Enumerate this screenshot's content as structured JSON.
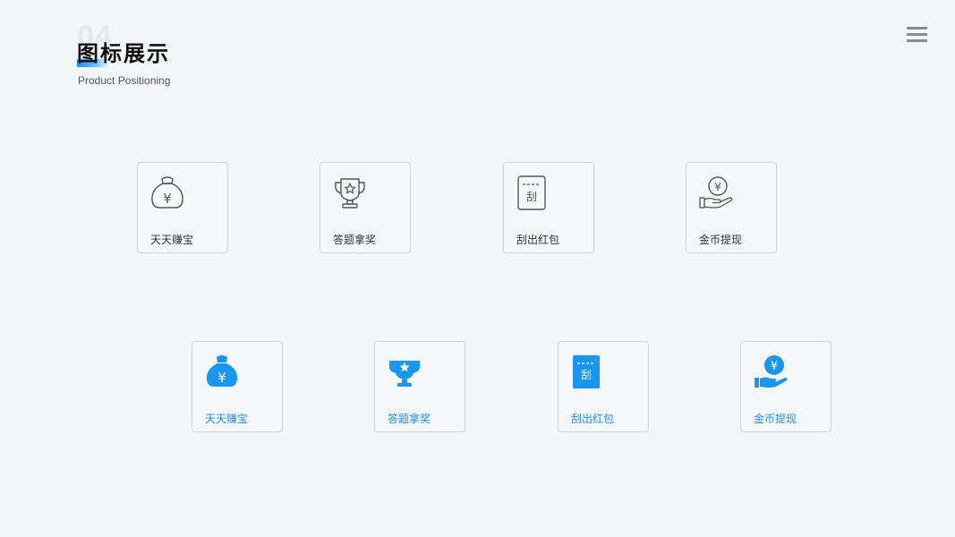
{
  "header": {
    "section_number": "04",
    "title": "图标展示",
    "subtitle": "Product Positioning"
  },
  "colors": {
    "accent": "#1a96f0",
    "outline": "#555555",
    "label_blue": "#1d8ff0"
  },
  "outline_icons": [
    {
      "icon": "money-bag-icon",
      "label": "天天赚宝"
    },
    {
      "icon": "trophy-icon",
      "label": "答题拿奖"
    },
    {
      "icon": "scratch-card-icon",
      "label": "刮出红包",
      "glyph": "刮"
    },
    {
      "icon": "coin-hand-icon",
      "label": "金币提现"
    }
  ],
  "filled_icons": [
    {
      "icon": "money-bag-icon",
      "label": "天天赚宝"
    },
    {
      "icon": "trophy-icon",
      "label": "答题拿奖"
    },
    {
      "icon": "scratch-card-icon",
      "label": "刮出红包",
      "glyph": "刮"
    },
    {
      "icon": "coin-hand-icon",
      "label": "金币提现"
    }
  ]
}
